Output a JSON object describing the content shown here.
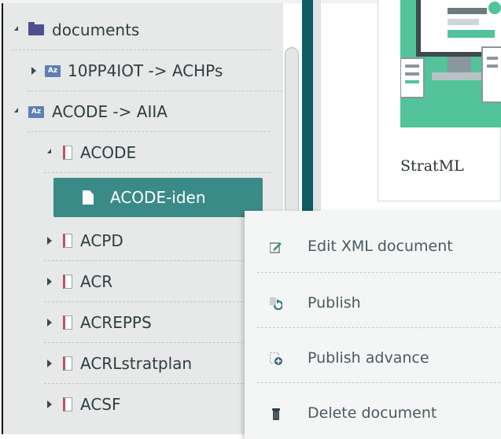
{
  "tree": {
    "root": {
      "label": "documents",
      "expanded": true,
      "icon": "folder-icon"
    },
    "nodes": [
      {
        "label": "10PP4IOT -> ACHPs",
        "expanded": false,
        "icon": "az-folder-icon"
      },
      {
        "label": "ACODE -> AIIA",
        "expanded": true,
        "icon": "az-folder-icon"
      },
      {
        "label": "ACODE",
        "expanded": true,
        "icon": "document-icon"
      },
      {
        "label": "ACODE-iden",
        "selected": true,
        "icon": "file-icon"
      },
      {
        "label": "ACPD",
        "expanded": false,
        "icon": "document-icon"
      },
      {
        "label": "ACR",
        "expanded": false,
        "icon": "document-icon"
      },
      {
        "label": "ACREPPS",
        "expanded": false,
        "icon": "document-icon"
      },
      {
        "label": "ACRLstratplan",
        "expanded": false,
        "icon": "document-icon"
      },
      {
        "label": "ACSF",
        "expanded": false,
        "icon": "document-icon"
      }
    ]
  },
  "card": {
    "title": "StratML"
  },
  "context_menu": {
    "items": [
      {
        "label": "Edit XML document",
        "icon": "edit-icon"
      },
      {
        "label": "Publish",
        "icon": "publish-icon"
      },
      {
        "label": "Publish advance",
        "icon": "publish-advance-icon"
      },
      {
        "label": "Delete document",
        "icon": "delete-icon"
      }
    ]
  },
  "colors": {
    "accent": "#3a8a88",
    "divider": "#0d5c61",
    "card_image": "#52c39a",
    "tree_background": "#e6e9e7"
  }
}
